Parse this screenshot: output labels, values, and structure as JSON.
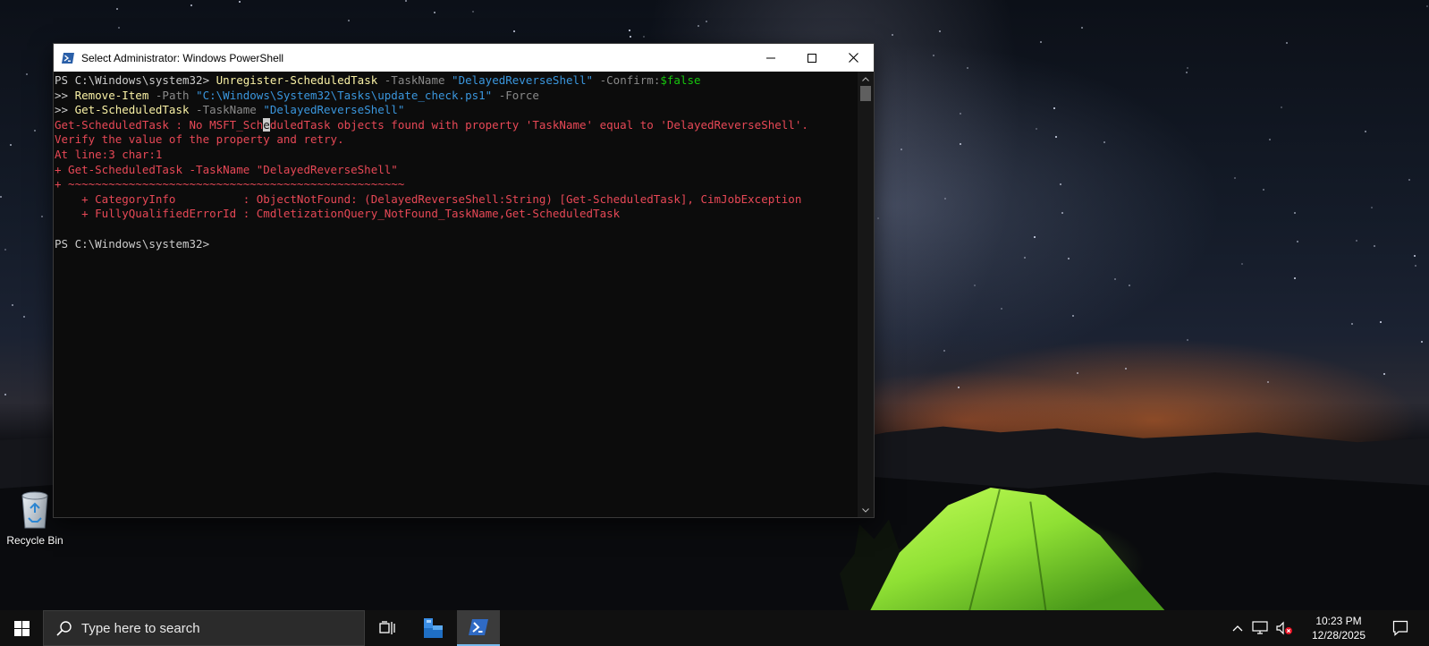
{
  "desktop": {
    "recycle_bin_label": "Recycle Bin"
  },
  "window": {
    "title": "Select Administrator: Windows PowerShell",
    "minimize_icon": "minimize-icon",
    "maximize_icon": "maximize-icon",
    "close_icon": "close-icon"
  },
  "console": {
    "lines": [
      [
        {
          "t": "PS C:\\Windows\\system32> ",
          "c": "default"
        },
        {
          "t": "Unregister-ScheduledTask",
          "c": "cmd"
        },
        {
          "t": " -TaskName ",
          "c": "param"
        },
        {
          "t": "\"DelayedReverseShell\"",
          "c": "str"
        },
        {
          "t": " -Confirm:",
          "c": "param"
        },
        {
          "t": "$false",
          "c": "var"
        }
      ],
      [
        {
          "t": ">> ",
          "c": "default"
        },
        {
          "t": "Remove-Item",
          "c": "cmd"
        },
        {
          "t": " -Path ",
          "c": "param"
        },
        {
          "t": "\"C:\\Windows\\System32\\Tasks\\update_check.ps1\"",
          "c": "str"
        },
        {
          "t": " -Force",
          "c": "param"
        }
      ],
      [
        {
          "t": ">> ",
          "c": "default"
        },
        {
          "t": "Get-ScheduledTask",
          "c": "cmd"
        },
        {
          "t": " -TaskName ",
          "c": "param"
        },
        {
          "t": "\"DelayedReverseShell\"",
          "c": "str"
        }
      ],
      [
        {
          "t": "Get-ScheduledTask : No MSFT_Sch",
          "c": "err"
        },
        {
          "t": "e",
          "c": "cursor"
        },
        {
          "t": "duledTask objects found with property 'TaskName' equal to 'DelayedReverseShell'.",
          "c": "err"
        }
      ],
      [
        {
          "t": "Verify the value of the property and retry.",
          "c": "err"
        }
      ],
      [
        {
          "t": "At line:3 char:1",
          "c": "err"
        }
      ],
      [
        {
          "t": "+ Get-ScheduledTask -TaskName \"DelayedReverseShell\"",
          "c": "err"
        }
      ],
      [
        {
          "t": "+ ~~~~~~~~~~~~~~~~~~~~~~~~~~~~~~~~~~~~~~~~~~~~~~~~~~",
          "c": "err"
        }
      ],
      [
        {
          "t": "    + CategoryInfo          : ObjectNotFound: (DelayedReverseShell:String) [Get-ScheduledTask], CimJobException",
          "c": "err"
        }
      ],
      [
        {
          "t": "    + FullyQualifiedErrorId : CmdletizationQuery_NotFound_TaskName,Get-ScheduledTask",
          "c": "err"
        }
      ],
      [
        {
          "t": "",
          "c": "default"
        }
      ],
      [
        {
          "t": "PS C:\\Windows\\system32>",
          "c": "default"
        }
      ]
    ]
  },
  "taskbar": {
    "search_placeholder": "Type here to search",
    "apps": [
      {
        "name": "Task View",
        "icon": "task-view-icon"
      },
      {
        "name": "File Explorer",
        "icon": "file-explorer-icon"
      },
      {
        "name": "Windows PowerShell",
        "icon": "powershell-icon",
        "active": true
      }
    ],
    "clock_time": "10:23 PM",
    "clock_date": "12/28/2025"
  },
  "colors": {
    "console_bg": "#0c0c0c",
    "default_text": "#cccccc",
    "command": "#f9f1a5",
    "parameter": "#8a8a8a",
    "string": "#3a96dd",
    "variable": "#16c60c",
    "error": "#e74856",
    "taskbar_bg": "#101010"
  }
}
